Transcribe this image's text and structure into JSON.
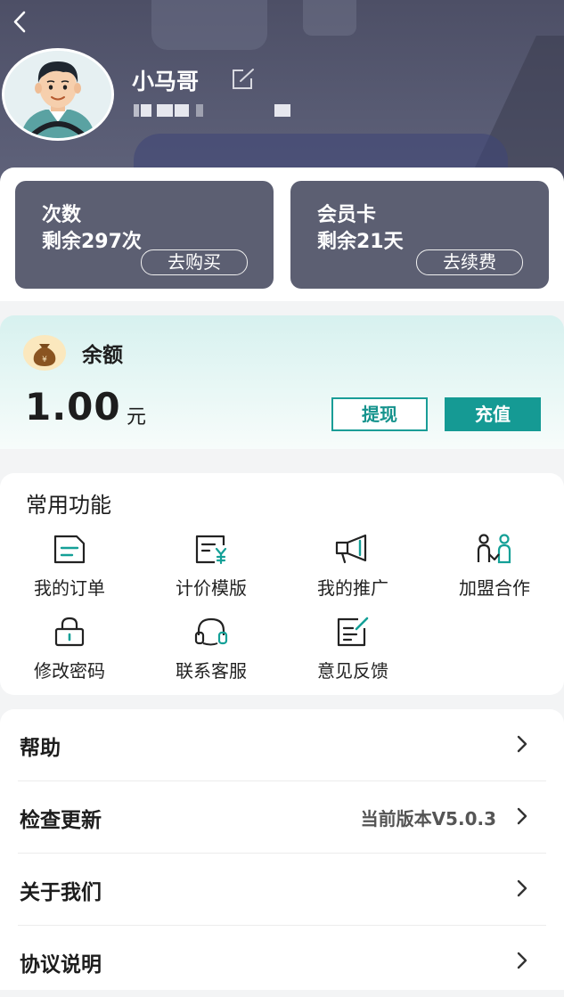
{
  "profile": {
    "username": "小马哥"
  },
  "stats": [
    {
      "line1": "次数",
      "line2": "剩余297次",
      "button": "去购买"
    },
    {
      "line1": "会员卡",
      "line2": "剩余21天",
      "button": "去续费"
    }
  ],
  "balance": {
    "label": "余额",
    "amount": "1.00",
    "unit": "元",
    "withdraw": "提现",
    "recharge": "充值"
  },
  "functions": {
    "title": "常用功能",
    "items": [
      {
        "label": "我的订单",
        "icon": "order-icon"
      },
      {
        "label": "计价模版",
        "icon": "pricing-template-icon"
      },
      {
        "label": "我的推广",
        "icon": "megaphone-icon"
      },
      {
        "label": "加盟合作",
        "icon": "partnership-icon"
      },
      {
        "label": "修改密码",
        "icon": "lock-icon"
      },
      {
        "label": "联系客服",
        "icon": "headset-icon"
      },
      {
        "label": "意见反馈",
        "icon": "feedback-icon"
      }
    ]
  },
  "menu": [
    {
      "label": "帮助",
      "value": ""
    },
    {
      "label": "检查更新",
      "value": "当前版本V5.0.3"
    },
    {
      "label": "关于我们",
      "value": ""
    },
    {
      "label": "协议说明",
      "value": ""
    }
  ],
  "colors": {
    "header": "#575a72",
    "card": "#5c5f72",
    "accent": "#159a94",
    "balance_bg": "#d7f1ef"
  }
}
